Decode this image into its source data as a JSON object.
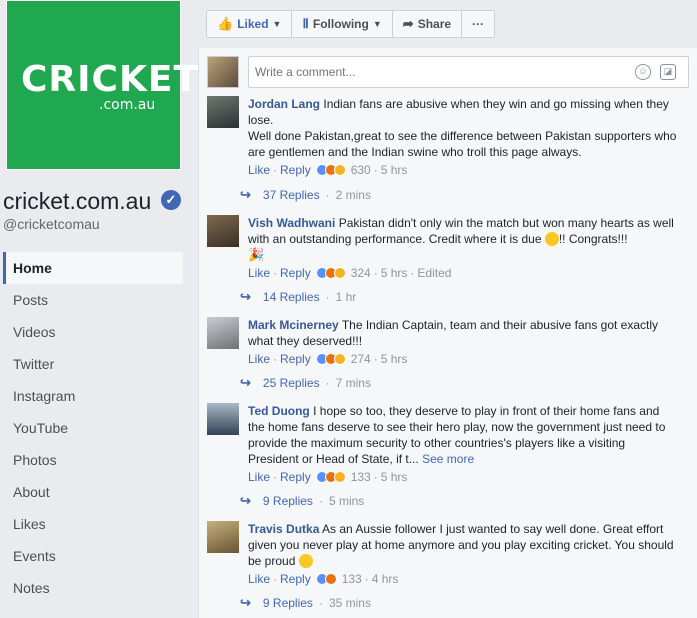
{
  "page": {
    "logo_brand": "CRICKET",
    "logo_sub": ".com.au",
    "name": "cricket.com.au",
    "handle": "@cricketcomau"
  },
  "nav": [
    "Home",
    "Posts",
    "Videos",
    "Twitter",
    "Instagram",
    "YouTube",
    "Photos",
    "About",
    "Likes",
    "Events",
    "Notes"
  ],
  "actions": {
    "liked": "Liked",
    "following": "Following",
    "share": "Share",
    "more": "···"
  },
  "composer": {
    "placeholder": "Write a comment..."
  },
  "comments": [
    {
      "author": "Jordan Lang",
      "text": "Indian fans are abusive when they win and go missing when they lose.",
      "text2": "Well done Pakistan,great to see the difference between Pakistan supporters who are gentlemen and the Indian swine who troll this page always.",
      "like": "Like",
      "reply": "Reply",
      "count": "630",
      "time": "5 hrs",
      "edited": "",
      "replies": "37 Replies",
      "replies_time": "2 mins"
    },
    {
      "author": "Vish Wadhwani",
      "text": "Pakistan didn't only win the match but won many hearts as well with an outstanding performance. Credit where it is due",
      "text_after": "!! Congrats!!!",
      "like": "Like",
      "reply": "Reply",
      "count": "324",
      "time": "5 hrs",
      "edited": "Edited",
      "replies": "14 Replies",
      "replies_time": "1 hr"
    },
    {
      "author": "Mark Mcinerney",
      "text": "The Indian Captain, team and their abusive fans got exactly what they deserved!!!",
      "like": "Like",
      "reply": "Reply",
      "count": "274",
      "time": "5 hrs",
      "edited": "",
      "replies": "25 Replies",
      "replies_time": "7 mins"
    },
    {
      "author": "Ted Duong",
      "text": "I hope so too, they deserve to play in front of their home fans and the home fans deserve to see their hero play, now the government just need to provide the maximum security to other countries's players like a visiting President or Head of State, if t...",
      "see_more": "See more",
      "like": "Like",
      "reply": "Reply",
      "count": "133",
      "time": "5 hrs",
      "edited": "",
      "replies": "9 Replies",
      "replies_time": "5 mins"
    },
    {
      "author": "Travis Dutka",
      "text": "As an Aussie follower I just wanted to say well done. Great effort given you never play at home anymore and you play exciting cricket. You should be proud",
      "like": "Like",
      "reply": "Reply",
      "count": "133",
      "time": "4 hrs",
      "edited": "",
      "replies": "9 Replies",
      "replies_time": "35 mins"
    }
  ]
}
